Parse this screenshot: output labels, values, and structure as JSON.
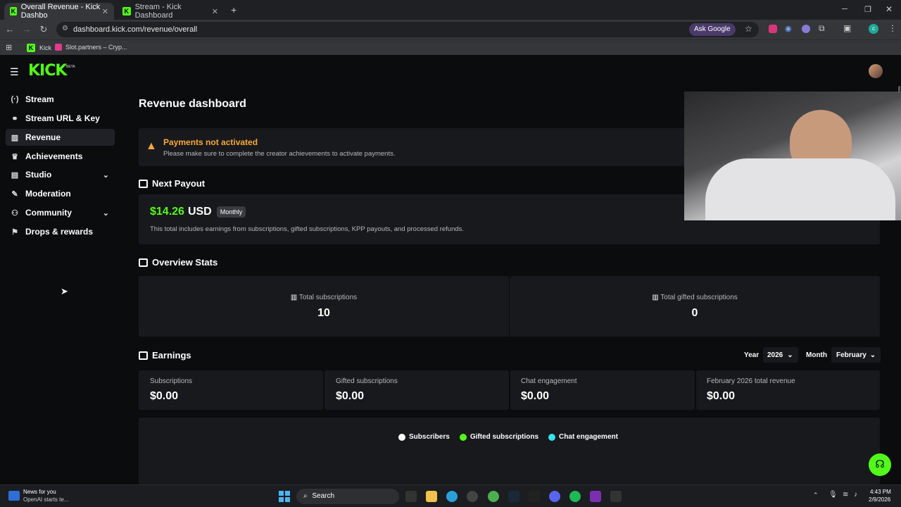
{
  "browser": {
    "tabs": [
      {
        "title": "Overall Revenue - Kick Dashbo"
      },
      {
        "title": "Stream - Kick Dashboard"
      }
    ],
    "url": "dashboard.kick.com/revenue/overall",
    "ask_google": "Ask Google",
    "bookmarks": [
      {
        "label": "Kick"
      },
      {
        "label": "Slot.partners – Cryp..."
      }
    ]
  },
  "app": {
    "logo": "KICK",
    "logo_badge": "BETA"
  },
  "sidebar": {
    "items": [
      {
        "label": "Stream",
        "icon": "broadcast-icon"
      },
      {
        "label": "Stream URL & Key",
        "icon": "link-icon"
      },
      {
        "label": "Revenue",
        "icon": "bar-chart-icon"
      },
      {
        "label": "Achievements",
        "icon": "trophy-icon"
      },
      {
        "label": "Studio",
        "icon": "studio-icon"
      },
      {
        "label": "Moderation",
        "icon": "wrench-icon"
      },
      {
        "label": "Community",
        "icon": "community-icon"
      },
      {
        "label": "Drops & rewards",
        "icon": "gift-icon"
      }
    ]
  },
  "main": {
    "title": "Revenue dashboard",
    "alert": {
      "title": "Payments not activated",
      "message": "Please make sure to complete the creator achievements to activate payments."
    },
    "payout": {
      "section_title": "Next Payout",
      "amount": "$14.26",
      "currency": "USD",
      "badge": "Monthly",
      "note": "This total includes earnings from subscriptions, gifted subscriptions, KPP payouts, and processed refunds."
    },
    "overview": {
      "section_title": "Overview Stats",
      "stats": [
        {
          "label": "Total subscriptions",
          "value": "10"
        },
        {
          "label": "Total gifted subscriptions",
          "value": "0"
        }
      ]
    },
    "earnings": {
      "section_title": "Earnings",
      "year_label": "Year",
      "year_value": "2026",
      "month_label": "Month",
      "month_value": "February",
      "cards": [
        {
          "label": "Subscriptions",
          "value": "$0.00"
        },
        {
          "label": "Gifted subscriptions",
          "value": "$0.00"
        },
        {
          "label": "Chat engagement",
          "value": "$0.00"
        },
        {
          "label": "February 2026 total revenue",
          "value": "$0.00"
        }
      ],
      "legend": [
        {
          "label": "Subscribers",
          "color": "#ffffff"
        },
        {
          "label": "Gifted subscriptions",
          "color": "#53fc18"
        },
        {
          "label": "Chat engagement",
          "color": "#38e0f0"
        }
      ]
    }
  },
  "taskbar": {
    "news_title": "News for you",
    "news_sub": "OpenAI starts te...",
    "search": "Search",
    "time": "4:43 PM",
    "date": "2/9/2026"
  },
  "colors": {
    "accent": "#53fc18",
    "warning": "#f7a93b"
  }
}
